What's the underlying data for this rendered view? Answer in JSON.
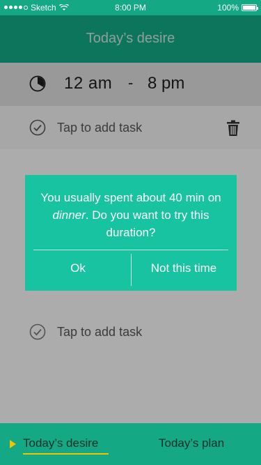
{
  "status_bar": {
    "carrier": "Sketch",
    "time": "8:00 PM",
    "battery": "100%"
  },
  "header": {
    "title": "Today’s desire"
  },
  "time_row": {
    "start": "12 am",
    "separator": "-",
    "end": "8 pm"
  },
  "tasks": [
    {
      "label": "Tap to add task"
    },
    {
      "label": "Tap to add task"
    }
  ],
  "dialog": {
    "message_part1": "You usually spent about 40 min on ",
    "message_emphasis": "dinner",
    "message_part2": ". Do you want to try this duration?",
    "ok_label": "Ok",
    "decline_label": "Not this time"
  },
  "tabbar": {
    "tab1": "Today’s desire",
    "tab2": "Today’s plan"
  },
  "colors": {
    "primary": "#14a884",
    "dialog": "#17c3a0",
    "accent": "#f2c400"
  }
}
